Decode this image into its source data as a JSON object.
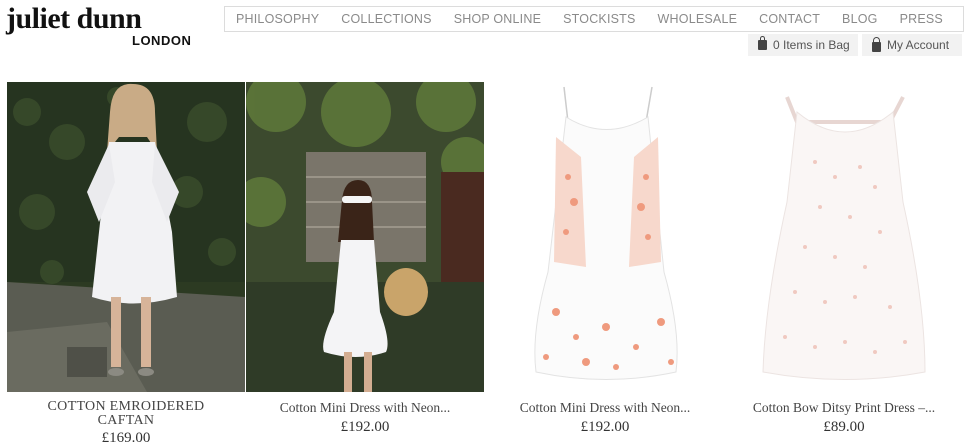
{
  "brand": {
    "name": "juliet dunn",
    "location": "LONDON"
  },
  "nav": [
    "PHILOSOPHY",
    "COLLECTIONS",
    "SHOP ONLINE",
    "STOCKISTS",
    "WHOLESALE",
    "CONTACT",
    "BLOG",
    "PRESS"
  ],
  "utility": {
    "bag_label": "0 Items in Bag",
    "account_label": "My Account"
  },
  "products": [
    {
      "name": "COTTON EMROIDERED CAFTAN",
      "price": "£169.00"
    },
    {
      "name": "Cotton Mini Dress with Neon...",
      "price": "£192.00"
    },
    {
      "name": "Cotton Mini Dress with Neon...",
      "price": "£192.00"
    },
    {
      "name": "Cotton Bow Ditsy Print Dress –...",
      "price": "£89.00"
    }
  ]
}
